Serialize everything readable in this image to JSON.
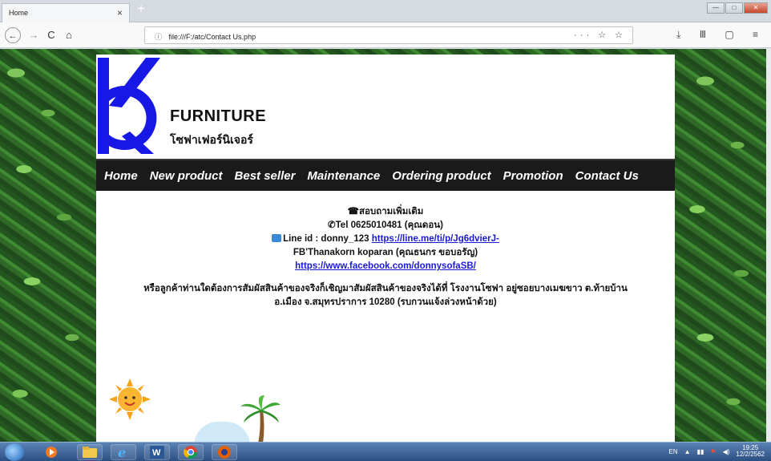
{
  "browser": {
    "tab_title": "Home",
    "tab_close": "×",
    "new_tab": "+",
    "url": "file:///F:/atc/Contact Us.php",
    "url_actions": "··· ☆ ☆",
    "info_icon": "ⓘ",
    "back": "←",
    "forward": "→",
    "reload": "C",
    "home": "⌂",
    "tools": "⤓ Ⅲ ▢ ≡",
    "win_min": "—",
    "win_max": "□",
    "win_close": "✕"
  },
  "site": {
    "brand": "FURNITURE",
    "brand_thai": "โซฟาเฟอร์นิเจอร์",
    "logo_letter": "K",
    "colors": {
      "logo_blue": "#1717e6",
      "menu_bg": "#1a1a1a",
      "link": "#1a1ad6"
    }
  },
  "menu": [
    {
      "label": "Home"
    },
    {
      "label": "New product"
    },
    {
      "label": "Best seller"
    },
    {
      "label": "Maintenance"
    },
    {
      "label": "Ordering product"
    },
    {
      "label": "Promotion"
    },
    {
      "label": "Contact Us"
    }
  ],
  "contact": {
    "heading": "สอบถามเพิ่มเติม",
    "tel": "Tel 0625010481 (คุณดอน)",
    "line_label": "Line id : donny_123",
    "line_link": "https://line.me/ti/p/Jg6dvierJ-",
    "fb_label": "FB'Thanakorn koparan (คุณธนกร ขอบอรัญ)",
    "fb_link": "https://www.facebook.com/donnysofaSB/",
    "visit_line1": "หรือลูกค้าท่านใดต้องการสัมผัสสินค้าของจริงก็เชิญมาสัมผัสสินค้าของจริงได้ที่ โรงงานโซฟา อยู่ซอยบางเมฆขาว ต.ท้ายบ้าน",
    "visit_line2": "อ.เมือง จ.สมุทรปราการ 10280 (รบกวนแจ้งล่วงหน้าด้วย)"
  },
  "taskbar": {
    "apps": [
      "start-orb",
      "media-player",
      "file-explorer",
      "internet-explorer",
      "word",
      "chrome",
      "firefox"
    ],
    "lang": "EN",
    "time": "19:25",
    "date": "12/2/2562"
  }
}
